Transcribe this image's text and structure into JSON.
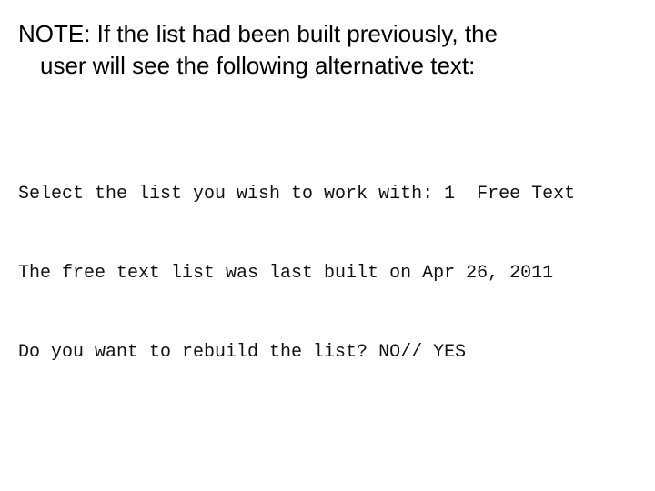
{
  "note": {
    "line1": "NOTE:  If the list had been built previously, the",
    "line2": "user will see the following alternative text:"
  },
  "terminal": {
    "lines": [
      "Select the list you wish to work with: 1  Free Text",
      "The free text list was last built on Apr 26, 2011",
      "Do you want to rebuild the list? NO// YES"
    ]
  }
}
